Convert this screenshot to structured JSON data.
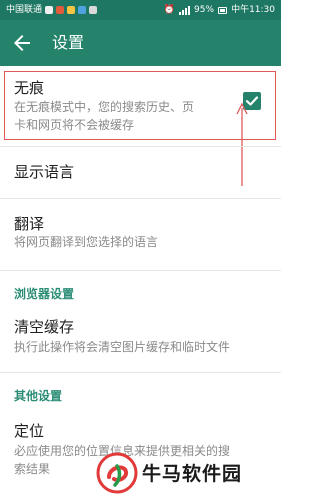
{
  "status_bar": {
    "carrier": "中国联通",
    "battery": "95%",
    "time": "中午11:30"
  },
  "app_bar": {
    "title": "设置",
    "back_icon": "arrow-back-icon"
  },
  "settings": {
    "incognito": {
      "title": "无痕",
      "subtitle_line1": "在无痕模式中，您的搜索历史、页",
      "subtitle_line2": "卡和网页将不会被缓存",
      "checked": true
    },
    "display_language": {
      "title": "显示语言"
    },
    "translate": {
      "title": "翻译",
      "subtitle": "将网页翻译到您选择的语言"
    },
    "browser_section": {
      "header": "浏览器设置"
    },
    "clear_cache": {
      "title": "清空缓存",
      "subtitle": "执行此操作将会清空图片缓存和临时文件"
    },
    "other_section": {
      "header": "其他设置"
    },
    "location": {
      "title": "定位",
      "subtitle_line1": "必应使用您的位置信息来提供更相关的搜",
      "subtitle_line2": "索结果"
    }
  },
  "watermark": {
    "text": "牛马软件园"
  },
  "colors": {
    "status_bar": "#1e7763",
    "app_bar": "#25836c",
    "accent": "#2b8d76",
    "highlight": "#e05a5a"
  }
}
